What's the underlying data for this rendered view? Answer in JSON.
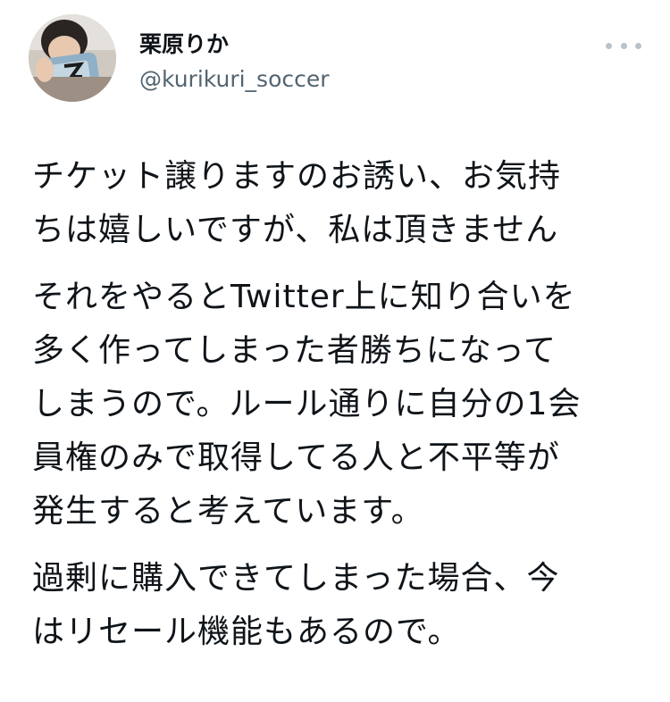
{
  "tweet": {
    "author": {
      "display_name": "栗原りか",
      "handle": "@kurikuri_soccer"
    },
    "menu_icon": "more-horizontal-icon",
    "paragraphs": [
      [
        "チケット譲りますのお誘い、お気持",
        "ちは嬉しいですが、私は頂きません"
      ],
      [
        "それをやるとTwitter上に知り合いを",
        "多く作ってしまった者勝ちになって",
        "しまうので。ルール通りに自分の1会",
        "員権のみで取得してる人と不平等が",
        "発生すると考えています。"
      ],
      [
        "過剰に購入できてしまった場合、今",
        "はリセール機能もあるので。"
      ]
    ]
  },
  "colors": {
    "text": "#0f1419",
    "secondary_text": "#536471",
    "menu_dots": "#b9c2c9"
  }
}
